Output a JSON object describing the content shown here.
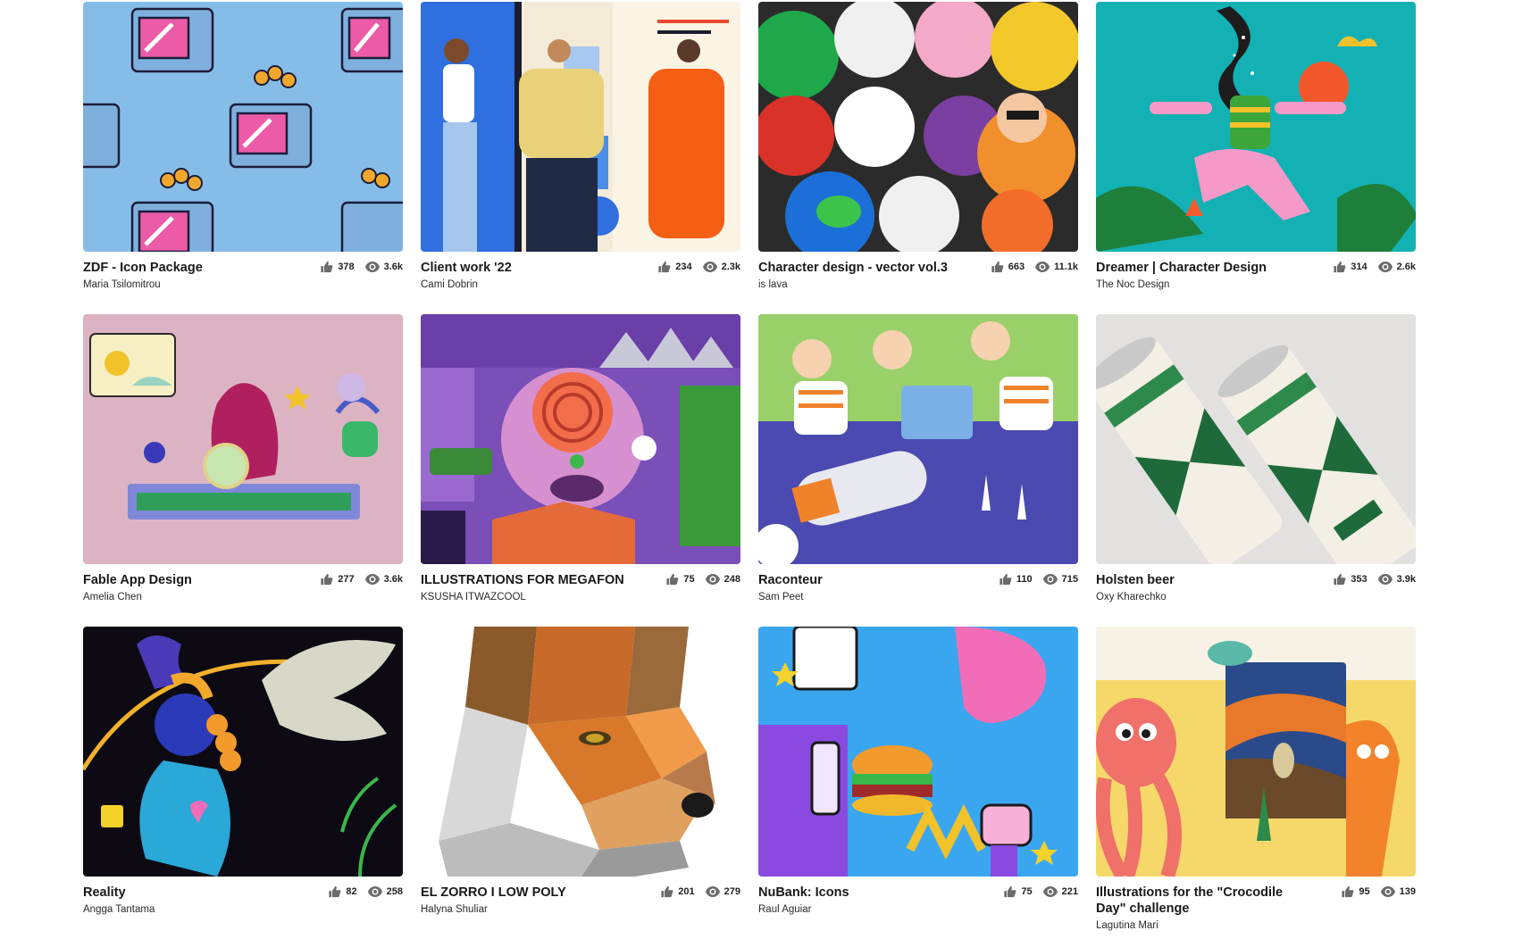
{
  "projects": [
    {
      "title": "ZDF - Icon Package",
      "owner": "Maria Tsilomitrou",
      "likes": "378",
      "views": "3.6k"
    },
    {
      "title": "Client work '22",
      "owner": "Cami Dobrin",
      "likes": "234",
      "views": "2.3k"
    },
    {
      "title": "Character design - vector vol.3",
      "owner": "is lava",
      "likes": "663",
      "views": "11.1k"
    },
    {
      "title": "Dreamer | Character Design",
      "owner": "The Noc Design",
      "likes": "314",
      "views": "2.6k"
    },
    {
      "title": "Fable App Design",
      "owner": "Amelia Chen",
      "likes": "277",
      "views": "3.6k"
    },
    {
      "title": "ILLUSTRATIONS FOR MEGAFON",
      "owner": "KSUSHA ITWAZCOOL",
      "likes": "75",
      "views": "248"
    },
    {
      "title": "Raconteur",
      "owner": "Sam Peet",
      "likes": "110",
      "views": "715"
    },
    {
      "title": "Holsten beer",
      "owner": "Oxy Kharechko",
      "likes": "353",
      "views": "3.9k"
    },
    {
      "title": "Reality",
      "owner": "Angga Tantama",
      "likes": "82",
      "views": "258"
    },
    {
      "title": "EL ZORRO I LOW POLY",
      "owner": "Halyna Shuliar",
      "likes": "201",
      "views": "279"
    },
    {
      "title": "NuBank: Icons",
      "owner": "Raul Aguiar",
      "likes": "75",
      "views": "221"
    },
    {
      "title": "Illustrations for the \"Crocodile Day\" challenge",
      "owner": "Lagutina Mari",
      "likes": "95",
      "views": "139"
    }
  ],
  "icons": {
    "like": "thumbs-up-icon",
    "views": "eye-icon"
  },
  "colors": {
    "text": "#191919",
    "stat_icon": "#6b6b6b",
    "background": "#ffffff"
  }
}
